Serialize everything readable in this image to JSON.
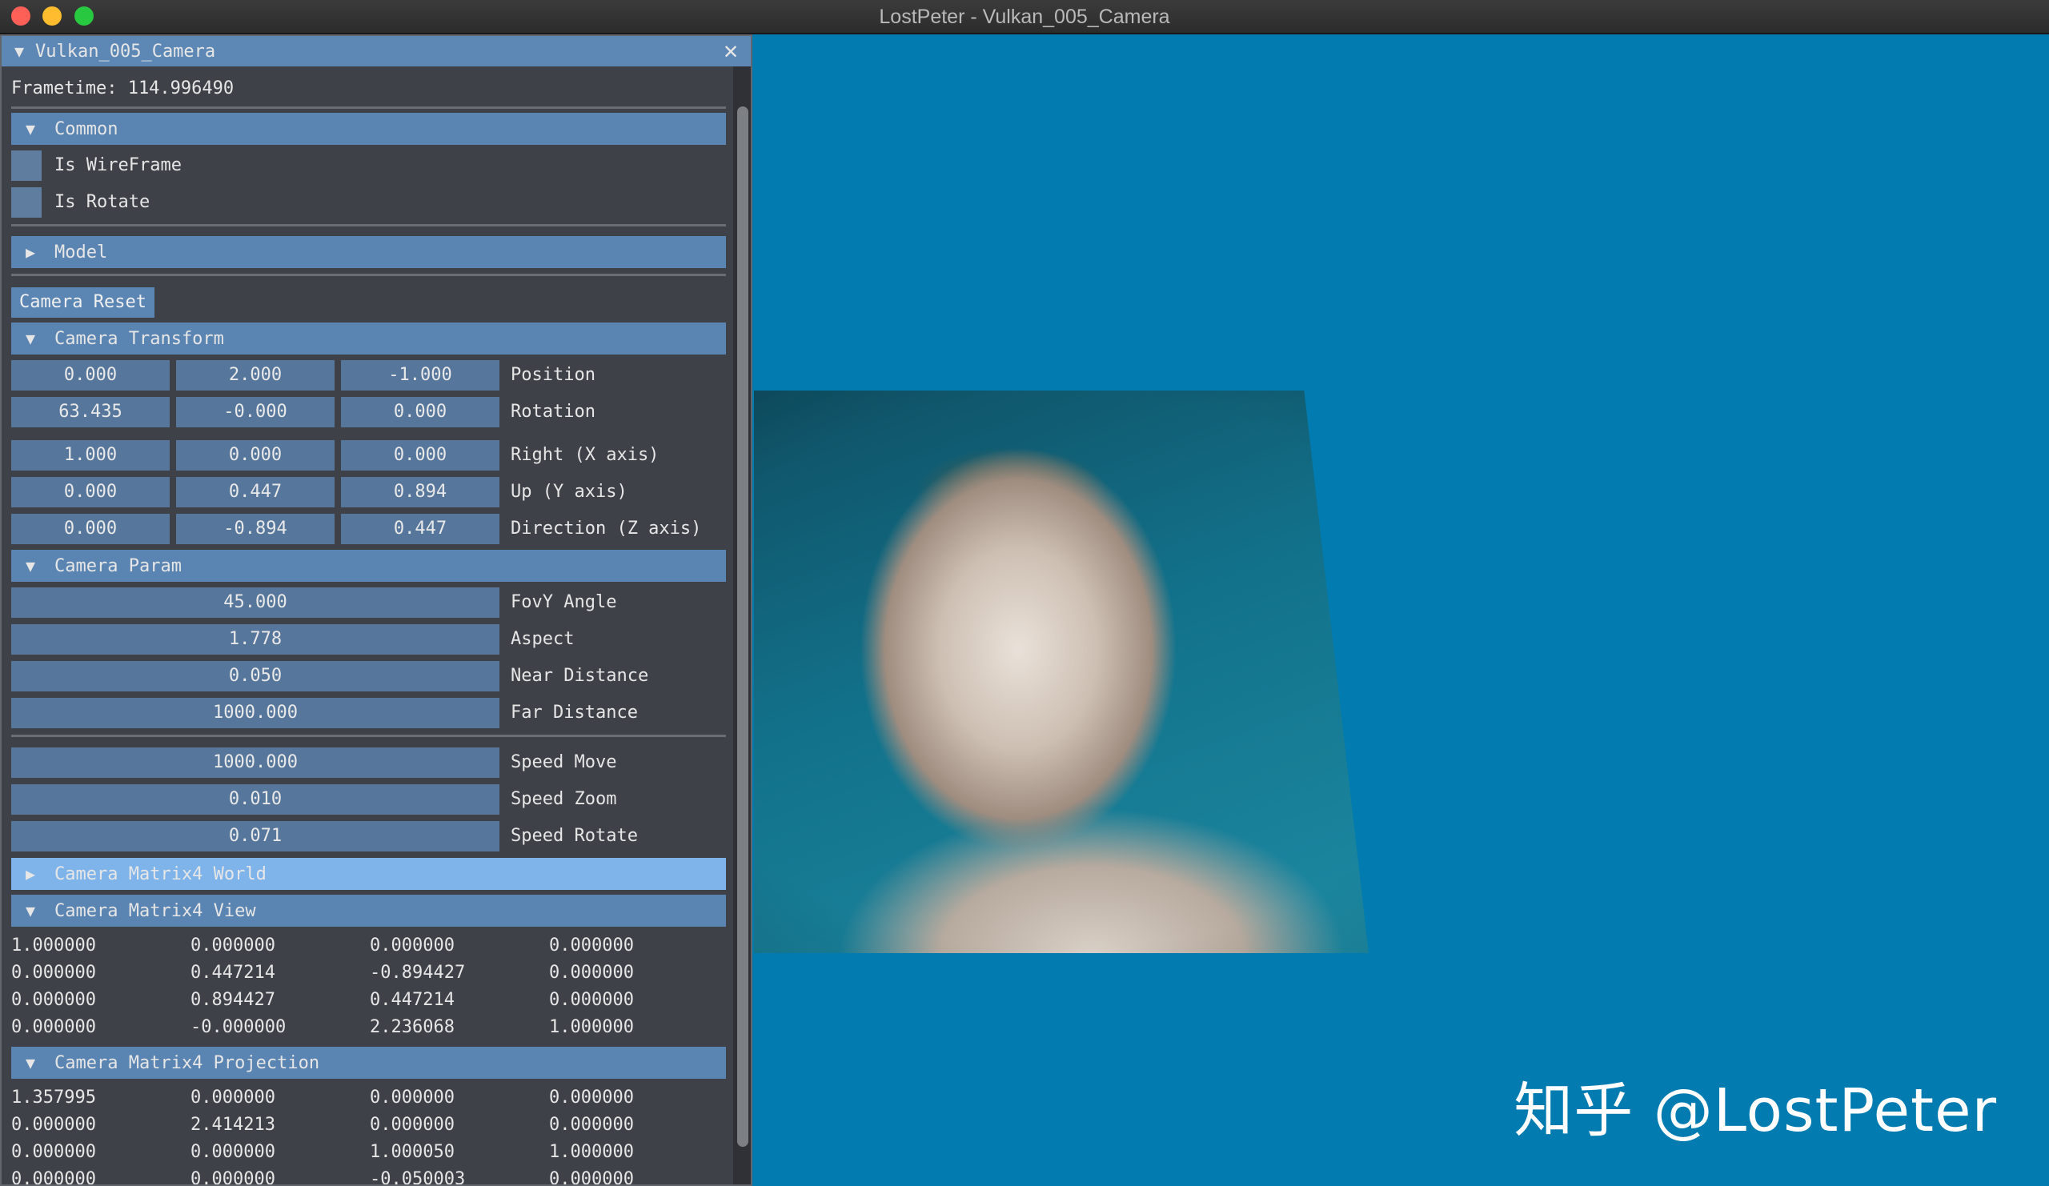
{
  "window": {
    "title": "LostPeter - Vulkan_005_Camera"
  },
  "panel": {
    "title": "Vulkan_005_Camera",
    "close_glyph": "✕",
    "frametime": "Frametime: 114.996490"
  },
  "common": {
    "label": "Common",
    "wireframe_label": "Is WireFrame",
    "wireframe_checked": false,
    "rotate_label": "Is Rotate",
    "rotate_checked": false
  },
  "model": {
    "label": "Model"
  },
  "camera_reset_label": "Camera Reset",
  "camera_transform": {
    "label": "Camera Transform",
    "rows": [
      {
        "label": "Position",
        "values": [
          "0.000",
          "2.000",
          "-1.000"
        ]
      },
      {
        "label": "Rotation",
        "values": [
          "63.435",
          "-0.000",
          "0.000"
        ]
      },
      {
        "label": "Right (X axis)",
        "values": [
          "1.000",
          "0.000",
          "0.000"
        ]
      },
      {
        "label": "Up (Y axis)",
        "values": [
          "0.000",
          "0.447",
          "0.894"
        ]
      },
      {
        "label": "Direction (Z axis)",
        "values": [
          "0.000",
          "-0.894",
          "0.447"
        ]
      }
    ]
  },
  "camera_param": {
    "label": "Camera Param",
    "rows": [
      {
        "label": "FovY Angle",
        "value": "45.000"
      },
      {
        "label": "Aspect",
        "value": "1.778"
      },
      {
        "label": "Near Distance",
        "value": "0.050"
      },
      {
        "label": "Far Distance",
        "value": "1000.000"
      },
      {
        "label": "Speed Move",
        "value": "1000.000"
      },
      {
        "label": "Speed Zoom",
        "value": "0.010"
      },
      {
        "label": "Speed Rotate",
        "value": "0.071"
      }
    ]
  },
  "matrix_world": {
    "label": "Camera Matrix4 World"
  },
  "matrix_view": {
    "label": "Camera Matrix4 View",
    "rows": [
      [
        "1.000000",
        "0.000000",
        "0.000000",
        "0.000000"
      ],
      [
        "0.000000",
        "0.447214",
        "-0.894427",
        "0.000000"
      ],
      [
        "0.000000",
        "0.894427",
        "0.447214",
        "0.000000"
      ],
      [
        "0.000000",
        "-0.000000",
        "2.236068",
        "1.000000"
      ]
    ]
  },
  "matrix_projection": {
    "label": "Camera Matrix4 Projection",
    "rows": [
      [
        "1.357995",
        "0.000000",
        "0.000000",
        "0.000000"
      ],
      [
        "0.000000",
        "2.414213",
        "0.000000",
        "0.000000"
      ],
      [
        "0.000000",
        "0.000000",
        "1.000050",
        "1.000000"
      ],
      [
        "0.000000",
        "0.000000",
        "-0.050003",
        "0.000000"
      ]
    ]
  },
  "icons": {
    "expanded": "▼",
    "collapsed": "▶"
  },
  "watermark": "知乎 @LostPeter",
  "colors": {
    "viewport_bg": "#017bb0",
    "header": "#5a84b1",
    "header_hover": "#7fb4ea",
    "field": "#56779b",
    "panel_bg": "#3e4147"
  }
}
